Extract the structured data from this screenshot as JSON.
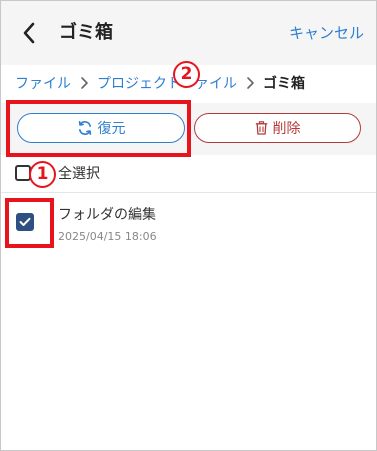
{
  "header": {
    "title": "ゴミ箱",
    "cancel_label": "キャンセル"
  },
  "breadcrumb": {
    "items": [
      "ファイル",
      "プロジェクトファイル"
    ],
    "current": "ゴミ箱"
  },
  "actions": {
    "restore_label": "復元",
    "delete_label": "削除"
  },
  "select_all": {
    "label": "全選択",
    "checked": false
  },
  "items": [
    {
      "name": "フォルダの編集",
      "date": "2025/04/15 18:06",
      "checked": true
    }
  ],
  "annotations": {
    "marker_1": "1",
    "marker_2": "2"
  },
  "colors": {
    "link": "#2f7fd1",
    "danger": "#b33b3b",
    "checkbox": "#2e4f82",
    "annotation": "#e8141d"
  },
  "icons": {
    "back": "chevron-left-icon",
    "separator": "chevron-right-icon",
    "restore": "restore-icon",
    "delete": "trash-icon",
    "checkmark": "checkmark-icon"
  }
}
